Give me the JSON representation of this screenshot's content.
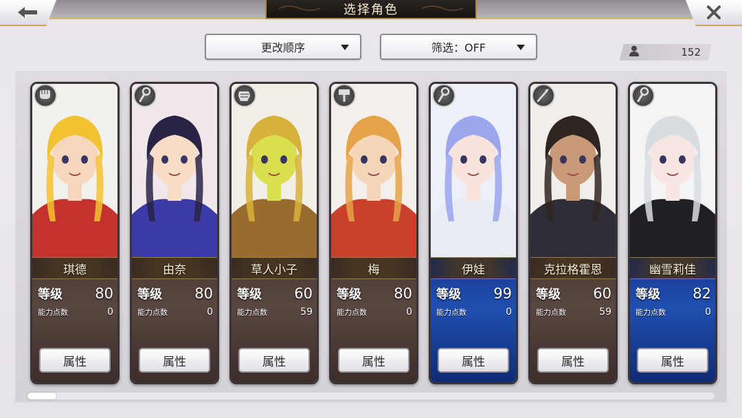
{
  "header": {
    "title": "选择角色",
    "back_icon": "arrow-left-icon",
    "close_icon": "close-icon"
  },
  "controls": {
    "order_label": "更改顺序",
    "filter_label": "筛选：OFF"
  },
  "roster_count": "152",
  "labels": {
    "level": "等级",
    "ability_points": "能力点数",
    "attributes_button": "属性"
  },
  "characters": [
    {
      "name": "琪德",
      "level": "80",
      "points": "0",
      "weapon_icon": "fist-icon",
      "frame": "normal",
      "palette": {
        "bg": "#f3f1ee",
        "hair": "#f2c233",
        "skin": "#f6d7bd",
        "cloth": "#c4322d"
      }
    },
    {
      "name": "由奈",
      "level": "80",
      "points": "0",
      "weapon_icon": "staff-icon",
      "frame": "normal",
      "palette": {
        "bg": "#f1e8ec",
        "hair": "#2a2346",
        "skin": "#f7dcc8",
        "cloth": "#3b3aa6"
      }
    },
    {
      "name": "草人小子",
      "level": "60",
      "points": "59",
      "weapon_icon": "gauntlet-icon",
      "frame": "normal",
      "palette": {
        "bg": "#f2efe6",
        "hair": "#d8b13a",
        "skin": "#d9df4f",
        "cloth": "#9a6b2e"
      }
    },
    {
      "name": "梅",
      "level": "80",
      "points": "0",
      "weapon_icon": "hammer-icon",
      "frame": "normal",
      "palette": {
        "bg": "#f4efea",
        "hair": "#e5a449",
        "skin": "#f6d6b9",
        "cloth": "#c9402b"
      }
    },
    {
      "name": "伊娃",
      "level": "99",
      "points": "0",
      "weapon_icon": "staff-icon",
      "frame": "rare",
      "palette": {
        "bg": "#eef0f7",
        "hair": "#9ba6ec",
        "skin": "#f8e3dd",
        "cloth": "#e8ecf4"
      }
    },
    {
      "name": "克拉格霍恩",
      "level": "60",
      "points": "59",
      "weapon_icon": "spear-icon",
      "frame": "normal",
      "palette": {
        "bg": "#f1ede9",
        "hair": "#2f2520",
        "skin": "#c99a78",
        "cloth": "#2f2e36"
      }
    },
    {
      "name": "幽雪莉佳",
      "level": "82",
      "points": "0",
      "weapon_icon": "staff-icon",
      "frame": "rare",
      "palette": {
        "bg": "#f4f4f5",
        "hair": "#d8dde2",
        "skin": "#f7e6e1",
        "cloth": "#1f1f24"
      }
    }
  ]
}
